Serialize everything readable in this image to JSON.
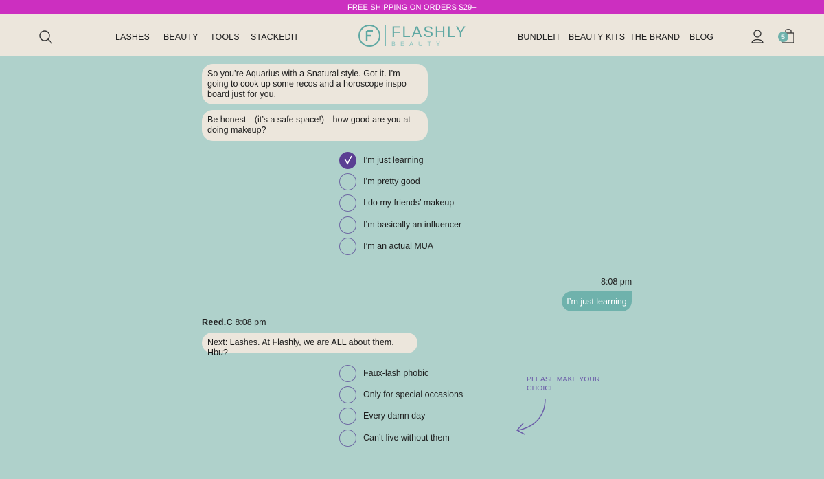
{
  "promo": {
    "text": "FREE SHIPPING ON ORDERS $29+"
  },
  "header": {
    "nav_left": [
      "LASHES",
      "BEAUTY",
      "TOOLS",
      "STACKEDIT"
    ],
    "nav_right": [
      "BUNDLEIT",
      "BEAUTY KITS",
      "THE BRAND",
      "BLOG"
    ],
    "logo": {
      "name": "FLASHLY",
      "sub": "BEAUTY"
    },
    "cart_count": "5",
    "icons": {
      "search": "search-icon",
      "account": "user-icon",
      "cart": "shopping-bag-icon"
    }
  },
  "chat": {
    "bot_messages_1": [
      "So you’re Aquarius with a Snatural style. Got it. I’m going to cook up some recos and a horoscope inspo board just for you.",
      "Be honest—(it’s a safe space!)—how good are you at doing makeup?"
    ],
    "skill_options": [
      {
        "label": "I’m just learning",
        "selected": true
      },
      {
        "label": "I’m pretty good",
        "selected": false
      },
      {
        "label": "I do my friends’ makeup",
        "selected": false
      },
      {
        "label": "I’m basically an influencer",
        "selected": false
      },
      {
        "label": "I’m an actual MUA",
        "selected": false
      }
    ],
    "user_reply": {
      "time": "8:08 pm",
      "text": "I’m just learning"
    },
    "bot_sender": {
      "name": "Reed.C",
      "time": "8:08 pm"
    },
    "bot_messages_2": [
      "Next: Lashes. At Flashly, we are ALL about them. Hbu?"
    ],
    "lash_options": [
      {
        "label": "Faux-lash phobic",
        "selected": false
      },
      {
        "label": "Only for special occasions",
        "selected": false
      },
      {
        "label": "Every damn day",
        "selected": false
      },
      {
        "label": "Can’t live without them",
        "selected": false
      }
    ],
    "hint": "PLEASE MAKE YOUR CHOICE"
  },
  "colors": {
    "promo": "#cc2fc0",
    "header": "#ece6dc",
    "background": "#afd1cb",
    "accent_teal": "#6fb2ac",
    "accent_purple": "#5b3f93",
    "bubble": "#ece6dc"
  }
}
